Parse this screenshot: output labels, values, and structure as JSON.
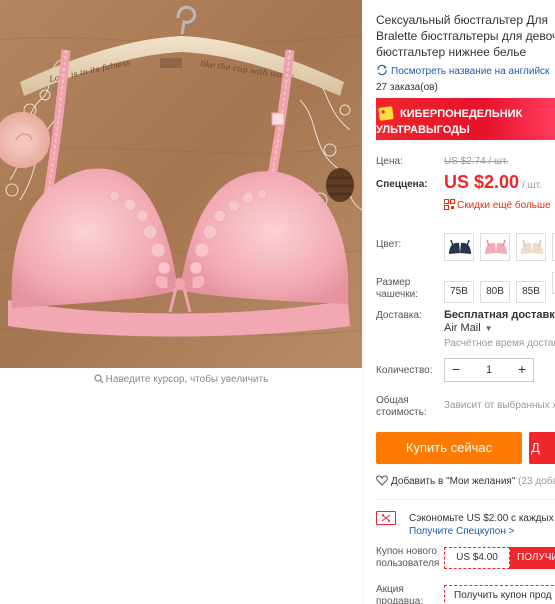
{
  "gallery": {
    "hanger_text_1": "Love is in its fulness",
    "hanger_text_2": "like the cup with water",
    "zoom_hint": "Наведите курсор, чтобы увеличить"
  },
  "product": {
    "title_lines": [
      "Сексуальный бюстгальтер Для",
      "Bralette бюстгальтеры для девоч",
      "бюстгальтер нижнее белье"
    ],
    "translate_link": "Посмотреть название на английск",
    "orders": "27 заказа(ов)"
  },
  "promo": {
    "line1": "КИБЕРПОНЕДЕЛЬНИК",
    "line2": "УЛЬТРАВЫГОДЫ"
  },
  "pricing": {
    "price_label": "Цена:",
    "old_price": "US $2.74 / шт.",
    "special_label": "Спеццена:",
    "new_price": "US $2.00",
    "unit": "/ шт.",
    "discount_link": "Скидки ещё больше"
  },
  "options": {
    "color_label": "Цвет:",
    "colors": [
      {
        "name": "navy",
        "hex": "#27324f"
      },
      {
        "name": "pink",
        "hex": "#f2aab3"
      },
      {
        "name": "beige",
        "hex": "#efdcc8"
      },
      {
        "name": "partial",
        "hex": "#f6e0e2"
      }
    ],
    "size_label": "Размер чашечки:",
    "sizes": [
      "75B",
      "80B",
      "85B"
    ]
  },
  "shipping": {
    "label": "Доставка:",
    "free": "Бесплатная доставка в",
    "method": "Air Mail",
    "time": "Расчётное время доставк"
  },
  "quantity": {
    "label": "Количество:",
    "value": "1",
    "minus": "−",
    "plus": "+"
  },
  "total": {
    "label": "Общая стоимость:",
    "hint": "Зависит от выбранных х"
  },
  "actions": {
    "buy": "Купить сейчас",
    "cart": "Д",
    "wishlist": "Добавить в \"Мои желания\"",
    "wishlist_count": "(23 добав"
  },
  "coupons": {
    "save_text": "Сэкономьте US $2.00 с каждых U",
    "get_coupon": "Получите Спецкупон >",
    "new_user_label": "Купон нового пользователя",
    "new_user_value": "US $4.00",
    "new_user_get": "ПОЛУЧИ",
    "seller_label": "Акция продавца:",
    "seller_button": "Получить купон прод"
  },
  "colors": {
    "accent_red": "#f0262d",
    "buy_orange": "#ff7a00",
    "link_blue": "#1a5bb5"
  }
}
